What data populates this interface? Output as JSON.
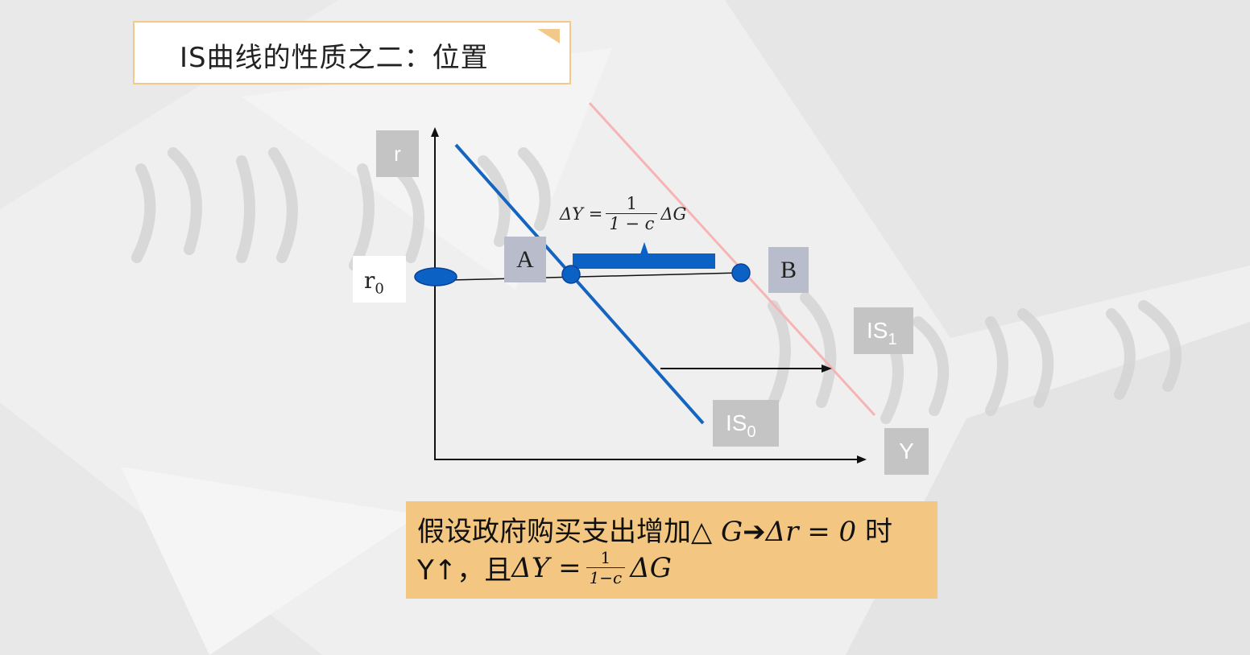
{
  "title": "IS曲线的性质之二：位置",
  "diagram": {
    "axis_y_label": "r",
    "axis_x_label": "Y",
    "r0_label": "r",
    "r0_sub": "0",
    "point_a": "A",
    "point_b": "B",
    "is0_label": "IS",
    "is0_sub": "0",
    "is1_label": "IS",
    "is1_sub": "1",
    "colors": {
      "is0": "#1565c0",
      "is1": "#f7b4b4",
      "point": "#0b62c4"
    }
  },
  "formula_top": {
    "lhs": "ΔY =",
    "num": "1",
    "den": "1 − c",
    "rhs": "ΔG"
  },
  "bottom": {
    "line1_text": "假设政府购买支出增加△ ",
    "line1_g": "G",
    "line1_arrow": "➔",
    "line1_delta_r": "Δr = 0",
    "line1_end": " 时",
    "line2_start": "Y↑，且",
    "line2_lhs": "ΔY =",
    "line2_num": "1",
    "line2_den": "1−c",
    "line2_rhs": "ΔG"
  }
}
